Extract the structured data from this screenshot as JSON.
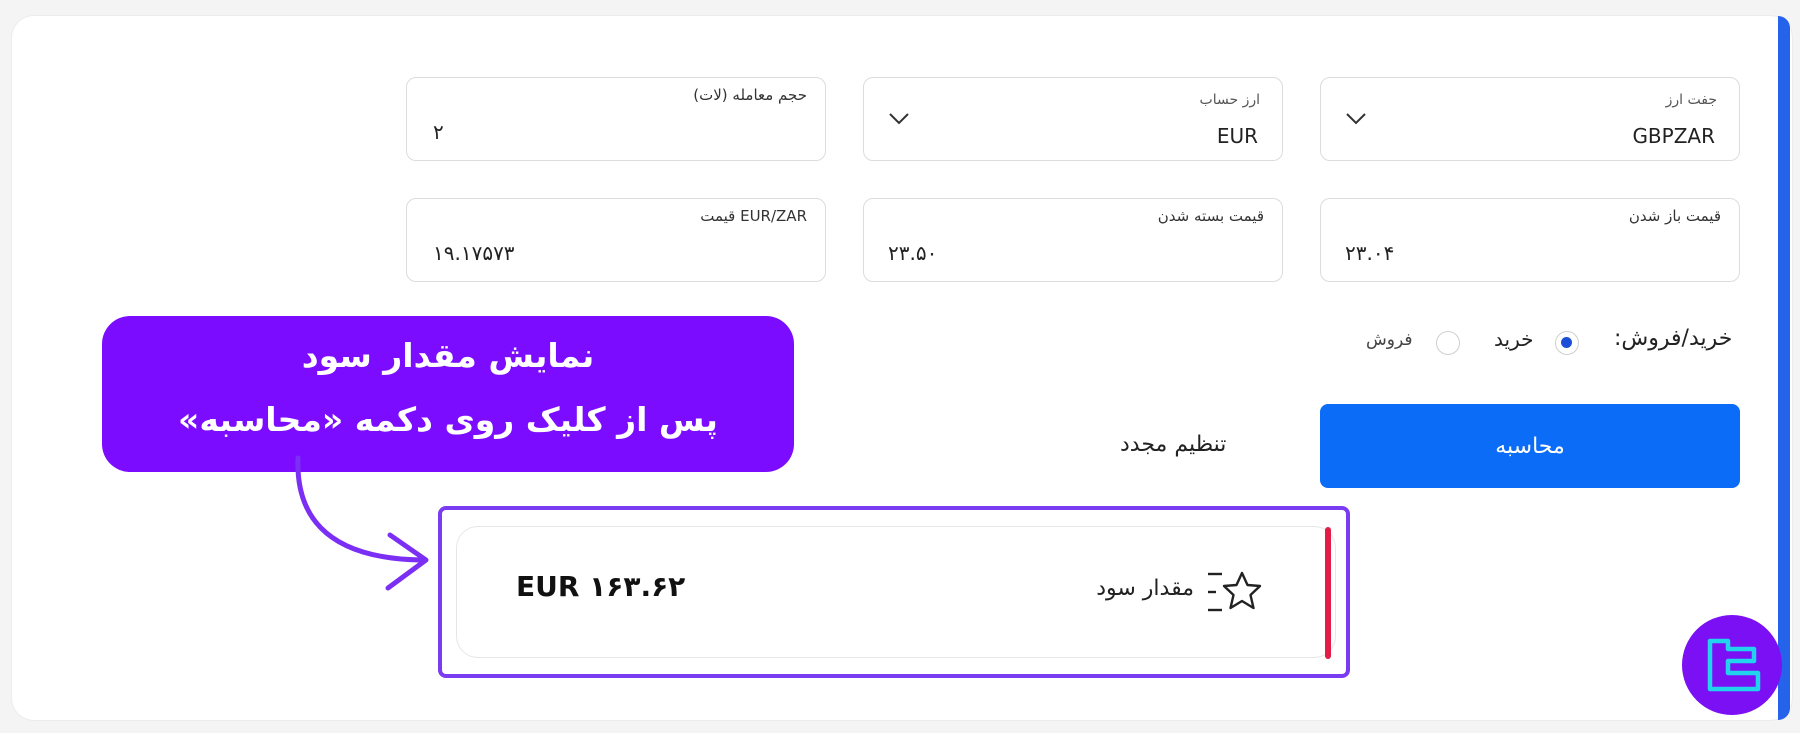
{
  "form": {
    "currency_pair": {
      "label": "جفت ارز",
      "value": "GBPZAR"
    },
    "account_currency": {
      "label": "ارز حساب",
      "value": "EUR"
    },
    "trade_volume": {
      "label": "حجم معامله (لات)",
      "value": "۲"
    },
    "open_price": {
      "label": "قیمت باز شدن",
      "value": "۲۳.۰۴"
    },
    "close_price": {
      "label": "قیمت بسته شدن",
      "value": "۲۳.۵۰"
    },
    "conversion_price": {
      "label": "EUR/ZAR قیمت",
      "value": "۱۹.۱۷۵۷۳"
    }
  },
  "direction": {
    "label": "خرید/فروش:",
    "options": [
      {
        "label": "خرید",
        "checked": true
      },
      {
        "label": "فروش",
        "checked": false
      }
    ]
  },
  "buttons": {
    "calculate": "محاسبه",
    "reset": "تنظیم مجدد"
  },
  "callout": {
    "line1": "نمایش مقدار سود",
    "line2": "پس از کلیک روی دکمه «محاسبه»"
  },
  "result": {
    "label": "مقدار سود",
    "value": "EUR ۱۶۳.۶۲",
    "icon": "star-list-icon"
  },
  "colors": {
    "primary": "#0b6cf7",
    "callout": "#7b0cff",
    "highlight_border": "#7a3cf0",
    "result_bar": "#e11d48",
    "accent_edge": "#2563eb"
  }
}
